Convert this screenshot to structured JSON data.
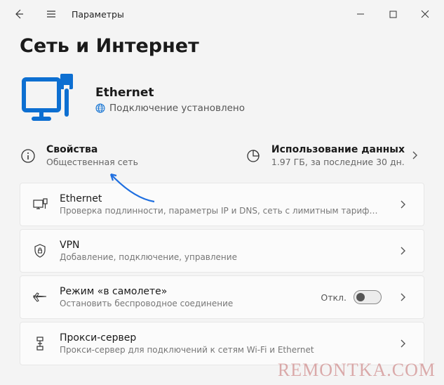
{
  "window": {
    "title": "Параметры"
  },
  "page": {
    "title": "Сеть и Интернет"
  },
  "hero": {
    "name": "Ethernet",
    "status": "Подключение установлено"
  },
  "quick": {
    "properties": {
      "title": "Свойства",
      "sub": "Общественная сеть"
    },
    "data_usage": {
      "title": "Использование данных",
      "sub": "1.97 ГБ, за последние 30 дн."
    }
  },
  "items": [
    {
      "title": "Ethernet",
      "sub": "Проверка подлинности, параметры IP и DNS, сеть с лимитным тарифным планом"
    },
    {
      "title": "VPN",
      "sub": "Добавление, подключение, управление"
    },
    {
      "title": "Режим «в самолете»",
      "sub": "Остановить беспроводное соединение",
      "toggle": "Откл."
    },
    {
      "title": "Прокси-сервер",
      "sub": "Прокси-сервер для подключений к сетям Wi-Fi и Ethernet"
    }
  ],
  "watermark": "REMONTKA.COM"
}
